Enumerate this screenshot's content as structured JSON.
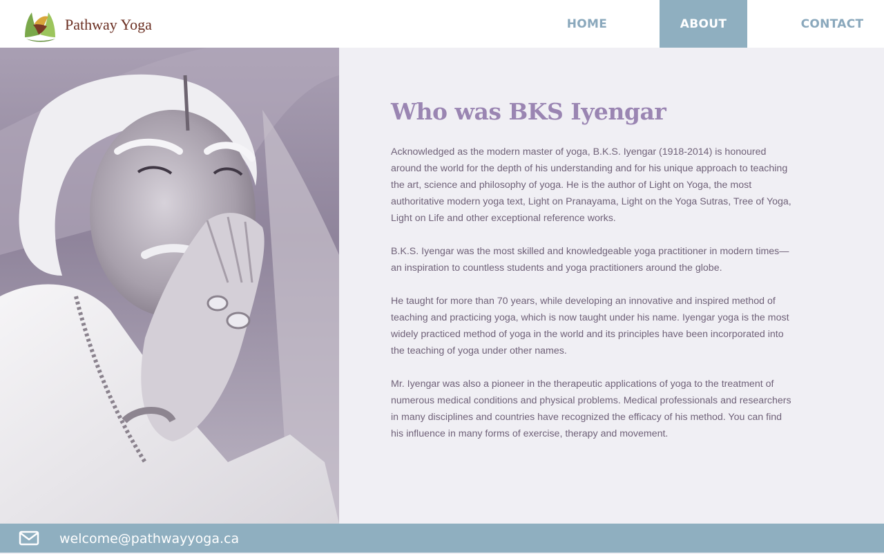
{
  "header": {
    "logo_text": "Pathway Yoga",
    "nav": [
      {
        "label": "HOME",
        "active": false
      },
      {
        "label": "ABOUT",
        "active": true
      },
      {
        "label": "CONTACT",
        "active": false
      }
    ]
  },
  "main": {
    "heading": "Who was BKS Iyengar",
    "paragraphs": [
      "Acknowledged as the modern master of yoga, B.K.S. Iyengar (1918-2014) is honoured around the world for the depth of his understanding and for his unique approach to teaching the art, science and philosophy of yoga. He is the author of Light on Yoga, the most authoritative modern yoga text, Light on Pranayama, Light on the Yoga Sutras, Tree of Yoga, Light on Life and other exceptional reference works.",
      "B.K.S. Iyengar was the most skilled and knowledgeable yoga practitioner in modern times—an inspiration to countless students and yoga practitioners around the globe.",
      "He taught for more than 70 years, while developing an innovative and inspired method of teaching and practicing yoga, which is now taught under his name. Iyengar yoga is the most widely practiced method of yoga in the world and its principles have been incorporated into the teaching of yoga under other names.",
      "Mr. Iyengar was also a pioneer in the therapeutic applications of yoga to the treatment of numerous medical conditions and physical problems. Medical professionals and researchers in many disciplines and countries have recognized the efficacy of his method. You can find his influence in many forms of exercise, therapy and movement."
    ]
  },
  "footer": {
    "email": "welcome@pathwayyoga.ca",
    "icon": "envelope-icon"
  },
  "colors": {
    "page_background": "#f0eff4",
    "header_background": "#ffffff",
    "nav_text": "#8aa8bc",
    "nav_active_background": "#8fafc0",
    "heading": "#9a85b2",
    "body_text": "#6f6178",
    "footer_background": "#8fafc0",
    "logo_text": "#6b2f22"
  },
  "photo": {
    "icon": "portrait-photo"
  }
}
